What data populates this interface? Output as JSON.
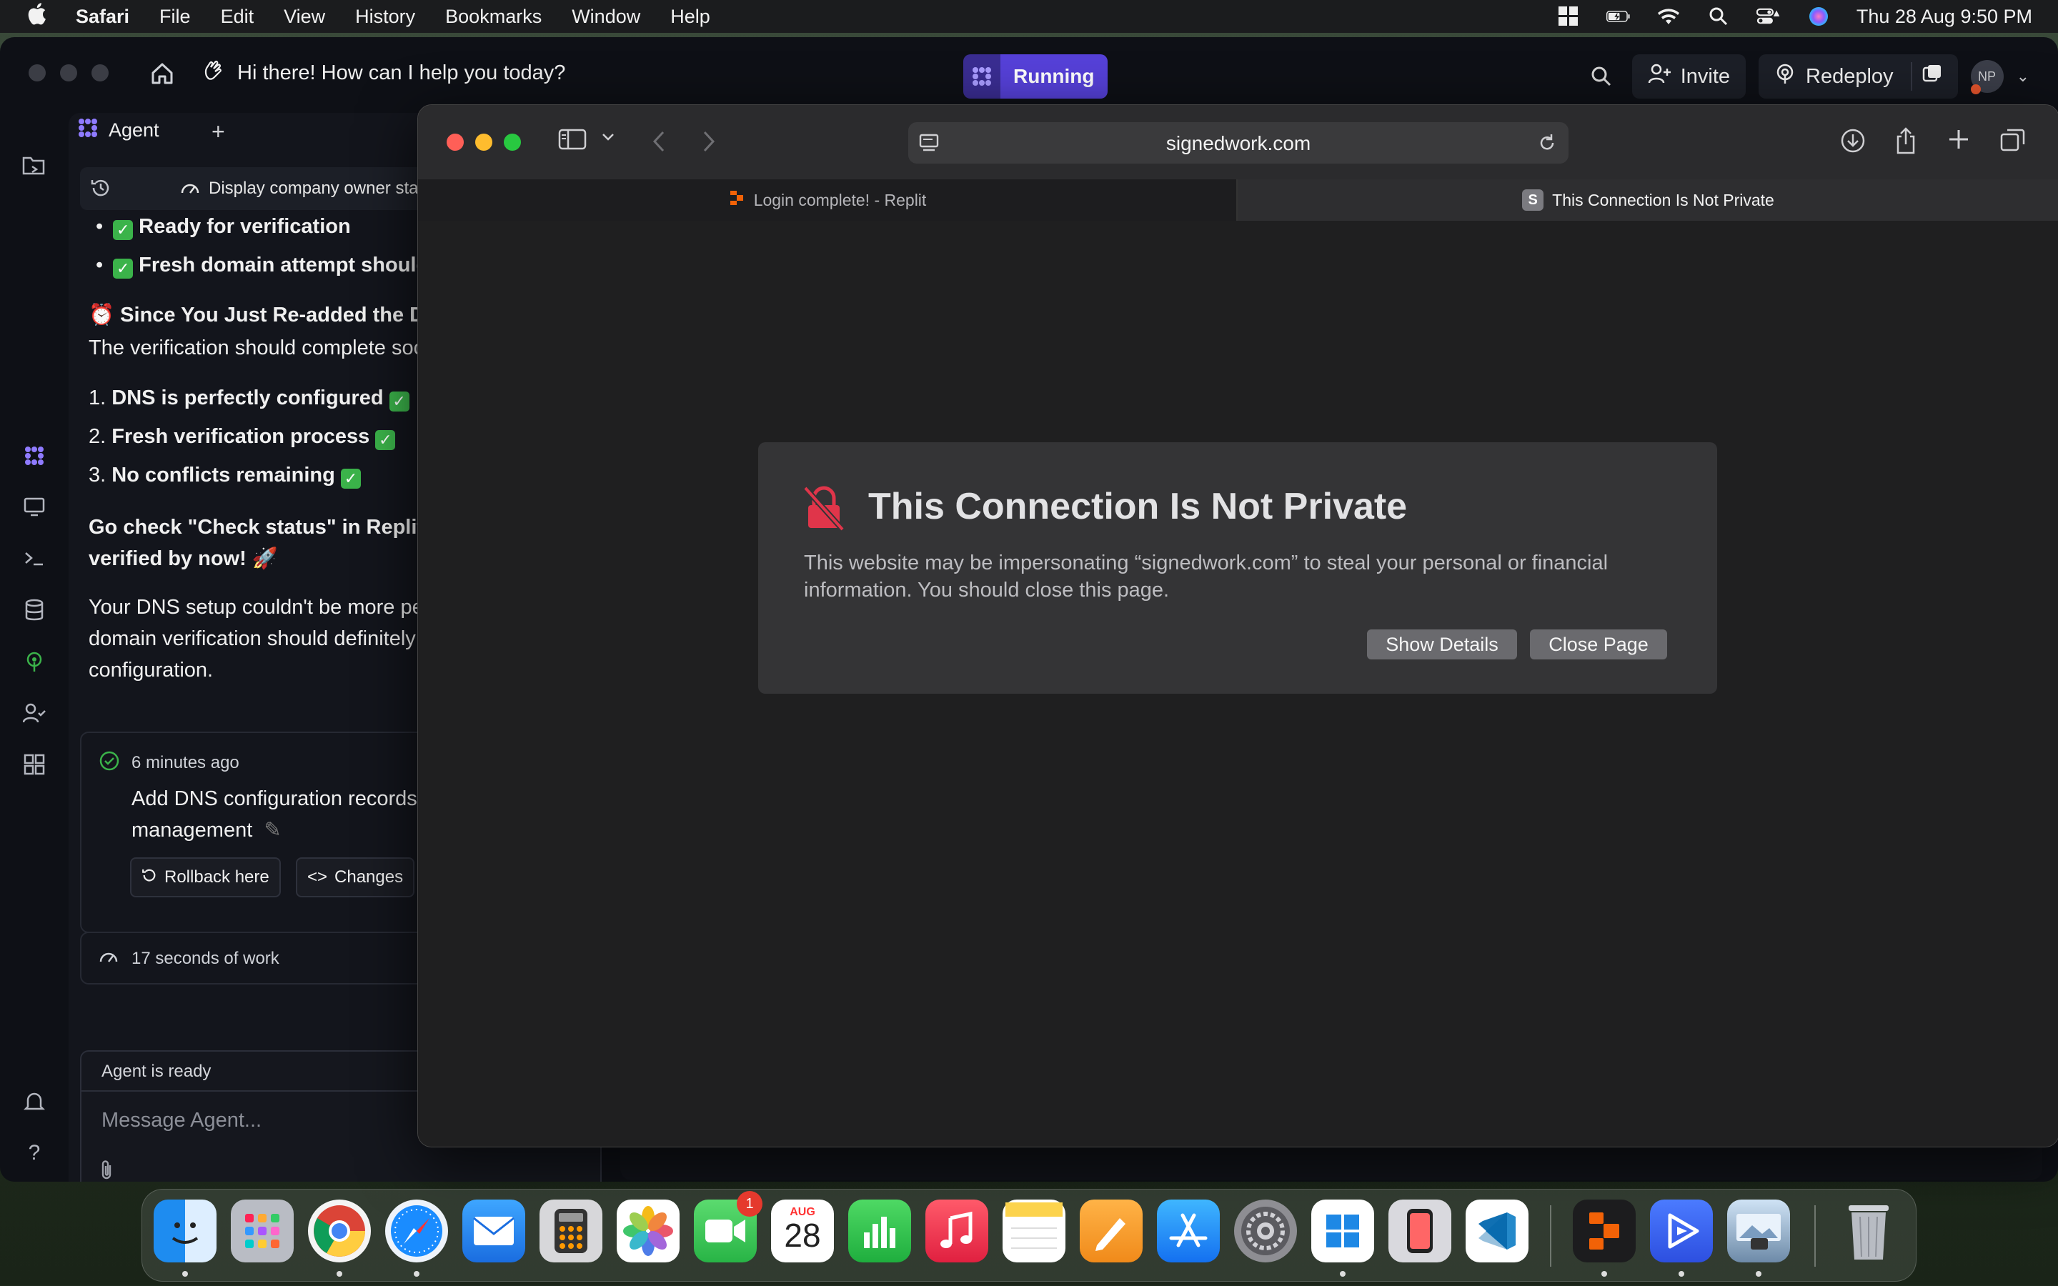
{
  "menubar": {
    "app": "Safari",
    "items": [
      "File",
      "Edit",
      "View",
      "History",
      "Bookmarks",
      "Window",
      "Help"
    ],
    "datetime": "Thu 28 Aug  9:50 PM"
  },
  "replit": {
    "greeting": "Hi there! How can I help you today?",
    "status": "Running",
    "invite": "Invite",
    "redeploy": "Redeploy",
    "avatar": "NP",
    "agent_tab": "Agent",
    "context_bar": "Display company owner stat",
    "chat": {
      "bullet1": "Ready for verification",
      "bullet2": "Fresh domain attempt should v",
      "heading": "Since You Just Re-added the Dor",
      "heading_body": "The verification should complete soo",
      "list1": "DNS is perfectly configured",
      "list2": "Fresh verification process",
      "list3": "No conflicts remaining",
      "go_check_1": "Go check \"Check status\" in Replit -",
      "go_check_2": "verified by now! 🚀",
      "para_1": "Your DNS setup couldn't be more per",
      "para_2": "domain verification should definitely",
      "para_3": "configuration."
    },
    "checkpoint": {
      "time": "6 minutes ago",
      "title_1": "Add DNS configuration records f",
      "title_2": "management",
      "rollback": "Rollback here",
      "changes": "Changes"
    },
    "work": "17 seconds of work",
    "agent_ready": "Agent is ready",
    "message_placeholder": "Message Agent..."
  },
  "safari": {
    "url": "signedwork.com",
    "tab1": "Login complete! - Replit",
    "tab2": "This Connection Is Not Private",
    "tab2_favicon": "S",
    "dialog": {
      "title": "This Connection Is Not Private",
      "body": "This website may be impersonating “signedwork.com” to steal your personal or financial information. You should close this page.",
      "show_details": "Show Details",
      "close_page": "Close Page"
    }
  },
  "dock": {
    "calendar_month": "AUG",
    "calendar_day": "28",
    "facetime_badge": "1"
  },
  "colors": {
    "running_accent": "#5641d9",
    "warning_red": "#e0354a",
    "check_green": "#3bb34a"
  }
}
